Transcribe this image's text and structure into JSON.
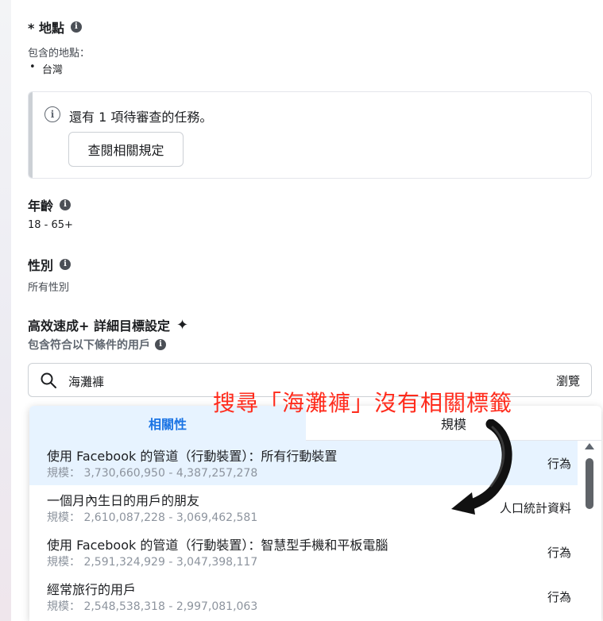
{
  "location": {
    "title": "* 地點",
    "included_label": "包含的地點：",
    "items": [
      "台灣"
    ]
  },
  "notice": {
    "text": "還有 1 項待審查的任務。",
    "button_label": "查閱相關規定"
  },
  "age": {
    "title": "年齡",
    "value": "18 - 65+"
  },
  "gender": {
    "title": "性別",
    "value": "所有性別"
  },
  "targeting": {
    "title": "高效速成+ 詳細目標設定",
    "hint": "包含符合以下條件的用戶",
    "search_value": "海灘褲",
    "browse_label": "瀏覽"
  },
  "annotation": {
    "text": "搜尋「海灘褲」沒有相關標籤",
    "color": "#ff2b1c"
  },
  "dropdown": {
    "tabs": [
      {
        "label": "相關性",
        "active": true
      },
      {
        "label": "規模",
        "active": false
      }
    ],
    "results": [
      {
        "title": "使用 Facebook 的管道（行動裝置）：所有行動裝置",
        "size": "規模： 3,730,660,950 - 4,387,257,278",
        "type": "行為",
        "highlighted": true
      },
      {
        "title": "一個月內生日的用戶的朋友",
        "size": "規模： 2,610,087,228 - 3,069,462,581",
        "type": "人口統計資料",
        "highlighted": false
      },
      {
        "title": "使用 Facebook 的管道（行動裝置）：智慧型手機和平板電腦",
        "size": "規模： 2,591,324,929 - 3,047,398,117",
        "type": "行為",
        "highlighted": false
      },
      {
        "title": "經常旅行的用戶",
        "size": "規模： 2,548,538,318 - 2,997,081,063",
        "type": "行為",
        "highlighted": false
      }
    ]
  },
  "colors": {
    "accent": "#1b74e4",
    "highlight": "#e7f3ff"
  }
}
